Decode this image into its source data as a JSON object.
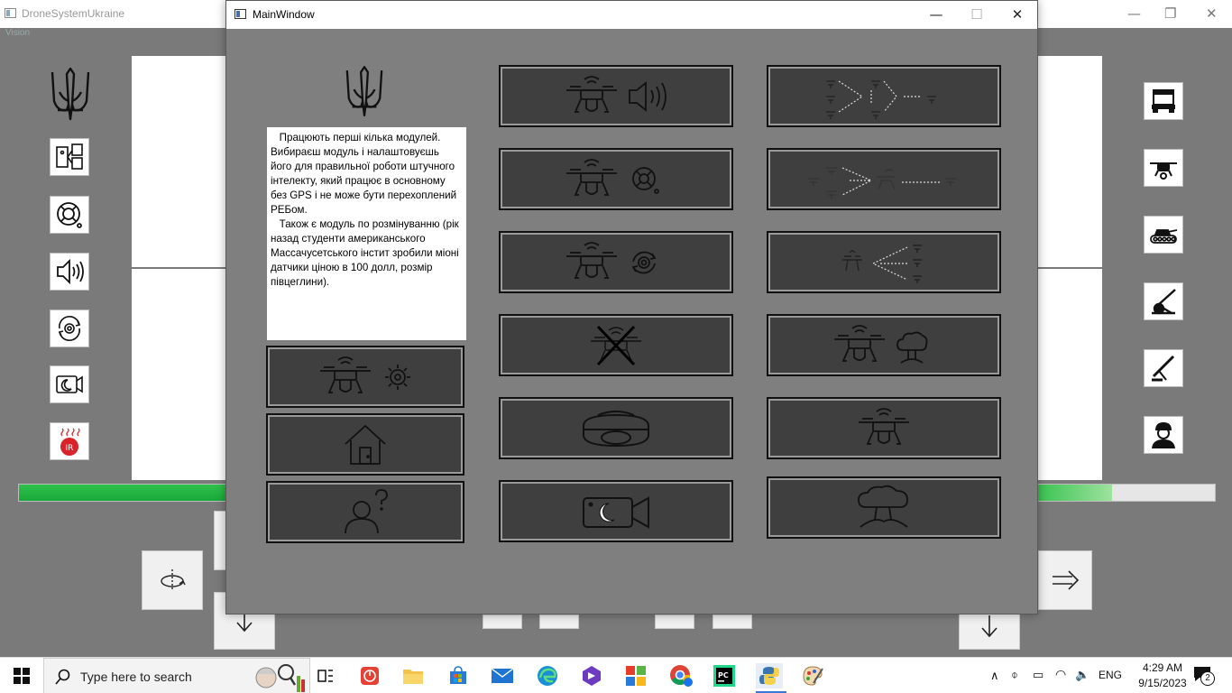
{
  "background_window": {
    "title": "DroneSystemUkraine",
    "menu_text": "Vision"
  },
  "dialog": {
    "title": "MainWindow",
    "info_text": "   Працюють перші кілька модулей. Вибираєш модуль і налаштовуєшь його для правильної роботи штучного інтелекту, який працює в основному без GPS і не може бути перехоплений РЕБом.\n   Також є модуль по розмінуванню (рік назад студенти американського Массачусетського інстит зробили міоні датчики ціною в 100 долл, розмір півцеглини)."
  },
  "left_sidebar_icons": [
    "trident-icon",
    "server-module-icon",
    "target-reticle-icon",
    "speaker-icon",
    "ai-cycle-icon",
    "night-camera-icon",
    "infrared-icon"
  ],
  "right_sidebar_icons": [
    "truck-icon",
    "drone-icon",
    "tank-icon",
    "artillery-icon",
    "mortar-icon",
    "soldier-icon"
  ],
  "progress": {
    "value_percent": 90
  },
  "modules": {
    "left": [
      "drone-settings",
      "home",
      "help-user"
    ],
    "middle": [
      "drone-speaker",
      "drone-target",
      "drone-ai",
      "drone-disabled",
      "night-vision",
      "night-camera"
    ],
    "right": [
      "swarm-relay",
      "swarm-chain",
      "swarm-gather",
      "drone-explosion",
      "drone-plain",
      "explosion"
    ]
  },
  "taskbar": {
    "search_placeholder": "Type here to search",
    "language": "ENG",
    "time": "4:29 AM",
    "date": "9/15/2023",
    "notification_count": "2"
  },
  "colors": {
    "accent": "#3b78d8",
    "progress": "#18a83a",
    "dialog_bg": "#7f7f7f",
    "button_bg": "#3f3f3f"
  }
}
